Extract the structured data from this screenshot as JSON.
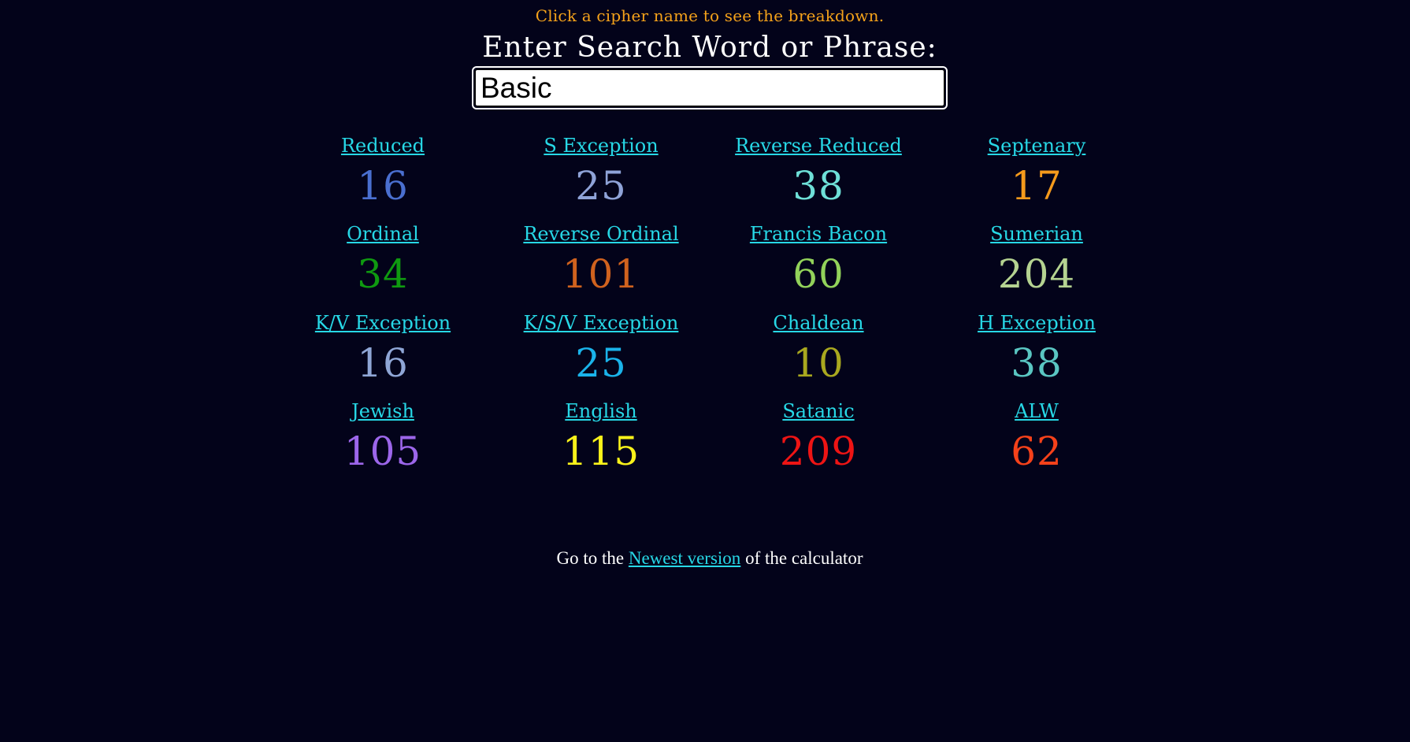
{
  "hint": "Click a cipher name to see the breakdown.",
  "prompt": "Enter Search Word or Phrase:",
  "search": {
    "value": "Basic"
  },
  "ciphers": [
    {
      "name": "Reduced",
      "value": "16",
      "color": "#4a6fd0"
    },
    {
      "name": "S Exception",
      "value": "25",
      "color": "#8fa3d8"
    },
    {
      "name": "Reverse Reduced",
      "value": "38",
      "color": "#6ee0d8"
    },
    {
      "name": "Septenary",
      "value": "17",
      "color": "#f59a1c"
    },
    {
      "name": "Ordinal",
      "value": "34",
      "color": "#0f9a10"
    },
    {
      "name": "Reverse Ordinal",
      "value": "101",
      "color": "#d0621e"
    },
    {
      "name": "Francis Bacon",
      "value": "60",
      "color": "#92d25a"
    },
    {
      "name": "Sumerian",
      "value": "204",
      "color": "#b5d391"
    },
    {
      "name": "K/V Exception",
      "value": "16",
      "color": "#8fa6d6"
    },
    {
      "name": "K/S/V Exception",
      "value": "25",
      "color": "#1ab3ea"
    },
    {
      "name": "Chaldean",
      "value": "10",
      "color": "#a9a81f"
    },
    {
      "name": "H Exception",
      "value": "38",
      "color": "#5ac6c2"
    },
    {
      "name": "Jewish",
      "value": "105",
      "color": "#9c66ea"
    },
    {
      "name": "English",
      "value": "115",
      "color": "#f9f21a"
    },
    {
      "name": "Satanic",
      "value": "209",
      "color": "#ee1414"
    },
    {
      "name": "ALW",
      "value": "62",
      "color": "#f5411a"
    }
  ],
  "footer": {
    "prefix": "Go to the",
    "link": "Newest version",
    "suffix": "of the calculator"
  }
}
